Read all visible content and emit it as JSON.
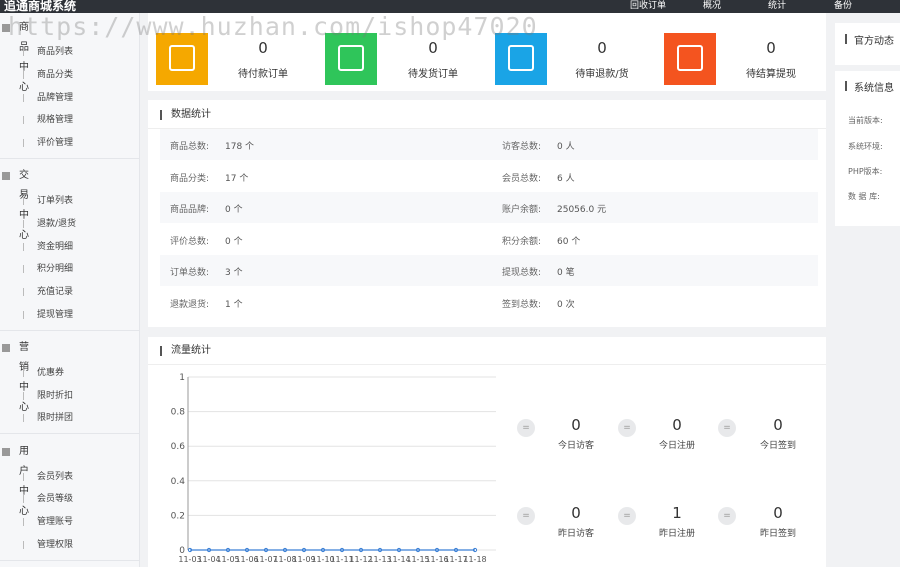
{
  "topbar": {
    "brand": "追通商城系统",
    "menu": [
      "回收订单",
      "概况",
      "统计",
      "备份"
    ]
  },
  "sidebar": {
    "groups": [
      {
        "title": "商品中心",
        "items": [
          "商品列表",
          "商品分类",
          "品牌管理",
          "规格管理",
          "评价管理"
        ]
      },
      {
        "title": "交易中心",
        "items": [
          "订单列表",
          "退款/退货",
          "资金明细",
          "积分明细",
          "充值记录",
          "提现管理"
        ]
      },
      {
        "title": "营销中心",
        "items": [
          "优惠券",
          "限时折扣",
          "限时拼团"
        ]
      },
      {
        "title": "用户中心",
        "items": [
          "会员列表",
          "会员等级",
          "管理账号",
          "管理权限"
        ]
      }
    ]
  },
  "order_stats": [
    {
      "count": "0",
      "label": "待付款订单",
      "color": "#f5a800",
      "icon": "wallet-icon"
    },
    {
      "count": "0",
      "label": "待发货订单",
      "color": "#2fc55a",
      "icon": "truck-icon"
    },
    {
      "count": "0",
      "label": "待审退款/货",
      "color": "#1aa4e6",
      "icon": "checkbox-icon"
    },
    {
      "count": "0",
      "label": "待结算提现",
      "color": "#f4541f",
      "icon": "calculator-icon"
    }
  ],
  "data_stats": {
    "title": "数据统计",
    "rows": [
      [
        {
          "key": "商品总数:",
          "value": "178 个"
        },
        {
          "key": "访客总数:",
          "value": "0 人"
        }
      ],
      [
        {
          "key": "商品分类:",
          "value": "17 个"
        },
        {
          "key": "会员总数:",
          "value": "6 人"
        }
      ],
      [
        {
          "key": "商品品牌:",
          "value": "0 个"
        },
        {
          "key": "账户余额:",
          "value": "25056.0 元"
        }
      ],
      [
        {
          "key": "评价总数:",
          "value": "0 个"
        },
        {
          "key": "积分余额:",
          "value": "60 个"
        }
      ],
      [
        {
          "key": "订单总数:",
          "value": "3 个"
        },
        {
          "key": "提现总数:",
          "value": "0 笔"
        }
      ],
      [
        {
          "key": "退款退货:",
          "value": "1 个"
        },
        {
          "key": "签到总数:",
          "value": "0 次"
        }
      ]
    ]
  },
  "traffic": {
    "title": "流量统计",
    "today": [
      {
        "count": "0",
        "label": "今日访客"
      },
      {
        "count": "0",
        "label": "今日注册"
      },
      {
        "count": "0",
        "label": "今日签到"
      }
    ],
    "yesterday": [
      {
        "count": "0",
        "label": "昨日访客"
      },
      {
        "count": "1",
        "label": "昨日注册"
      },
      {
        "count": "0",
        "label": "昨日签到"
      }
    ],
    "circle_symbol": "="
  },
  "chart_data": {
    "type": "line",
    "yticks": [
      "1",
      "0.8",
      "0.6",
      "0.4",
      "0.2",
      "0"
    ],
    "ylim": [
      0,
      1
    ],
    "xlabels": [
      "11-03",
      "11-04",
      "11-05",
      "11-06",
      "11-07",
      "11-08",
      "11-09",
      "11-10",
      "11-11",
      "11-12",
      "11-13",
      "11-14",
      "11-15",
      "11-16",
      "11-17",
      "11-18"
    ],
    "series": [
      {
        "values": [
          0,
          0,
          0,
          0,
          0,
          0,
          0,
          0,
          0,
          0,
          0,
          0,
          0,
          0,
          0,
          0
        ]
      }
    ],
    "line_color": "#3a7fd5",
    "grid": true
  },
  "right": {
    "news_title": "官方动态",
    "sys_title": "系统信息",
    "sys_items": [
      "当前版本:",
      "系统环境:",
      "PHP版本:",
      "数 据 库:"
    ]
  },
  "watermark": "https://www.huzhan.com/ishop47020"
}
